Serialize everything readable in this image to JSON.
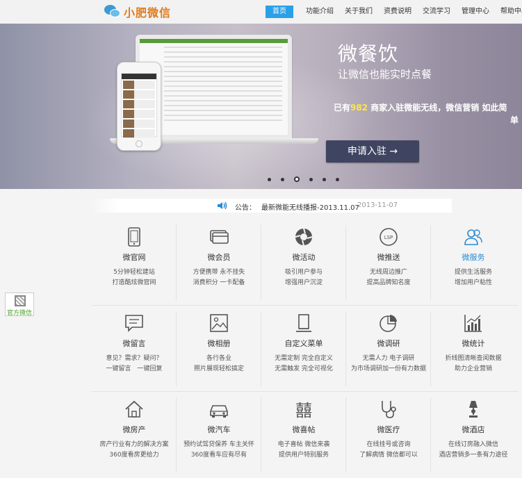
{
  "brand": {
    "name": "小肥微信"
  },
  "nav": [
    {
      "label": "首页",
      "active": true
    },
    {
      "label": "功能介绍"
    },
    {
      "label": "关于我们"
    },
    {
      "label": "资费说明"
    },
    {
      "label": "交流学习"
    },
    {
      "label": "管理中心"
    },
    {
      "label": "帮助中心"
    }
  ],
  "banner": {
    "title": "微餐饮",
    "subtitle": "让微信也能实时点餐",
    "line_prefix": "已有",
    "count": "982",
    "line_suffix": "商家入驻微能无线，微信营销 如此简",
    "line_tail": "单",
    "apply_label": "申请入驻 →",
    "slides": 6,
    "active_slide": 3
  },
  "notice": {
    "label": "公告：",
    "text": "最新微能无线播报-2013.11.07",
    "date": "2013-11-07"
  },
  "side": {
    "label": "官方微信"
  },
  "colors": {
    "accent": "#2aa0e8",
    "brand": "#e07a1a",
    "highlight": "#ffe54a",
    "button_dark": "#3f4460"
  },
  "features": [
    [
      {
        "icon": "phone-icon",
        "title": "微官网",
        "d1": "5分钟轻松建站",
        "d2": "打造酷炫微官网"
      },
      {
        "icon": "card-icon",
        "title": "微会员",
        "d1": "方便携带 永不挂失",
        "d2": "消费积分 一卡配备"
      },
      {
        "icon": "aperture-icon",
        "title": "微活动",
        "d1": "吸引用户参与",
        "d2": "增强用户沉淀"
      },
      {
        "icon": "lsp-icon",
        "title": "微推送",
        "d1": "无线周边推广",
        "d2": "提高品牌知名度"
      },
      {
        "icon": "users-icon",
        "title": "微服务",
        "d1": "提供生活服务",
        "d2": "增加用户粘性",
        "highlight": true
      }
    ],
    [
      {
        "icon": "message-icon",
        "title": "微留言",
        "d1": "意见？需求？疑问？",
        "d2": "一键留言　一键回复"
      },
      {
        "icon": "image-icon",
        "title": "微相册",
        "d1": "各行各业",
        "d2": "照片展现轻松搞定"
      },
      {
        "icon": "menu-icon",
        "title": "自定义菜单",
        "d1": "无需定制 完全自定义",
        "d2": "无需触发 完全可视化"
      },
      {
        "icon": "pie-chart-icon",
        "title": "微调研",
        "d1": "无需人力 电子调研",
        "d2": "为市场调研加一份有力数据"
      },
      {
        "icon": "bar-chart-icon",
        "title": "微统计",
        "d1": "折线图清晰查阅数据",
        "d2": "助力企业营销"
      }
    ],
    [
      {
        "icon": "house-icon",
        "title": "微房产",
        "d1": "房产行业有力的解决方案",
        "d2": "360度看房更给力"
      },
      {
        "icon": "car-icon",
        "title": "微汽车",
        "d1": "预约试驾贷保养 车主关怀",
        "d2": "360度看车应有尽有"
      },
      {
        "icon": "double-happiness-icon",
        "title": "微喜帖",
        "d1": "电子喜帖 微信来袭",
        "d2": "提供用户特别服务"
      },
      {
        "icon": "stethoscope-icon",
        "title": "微医疗",
        "d1": "在线挂号或咨询",
        "d2": "了解病情 微信都可以"
      },
      {
        "icon": "lamp-icon",
        "title": "微酒店",
        "d1": "在线订房融入微信",
        "d2": "酒店营销多一条有力途径"
      }
    ]
  ]
}
